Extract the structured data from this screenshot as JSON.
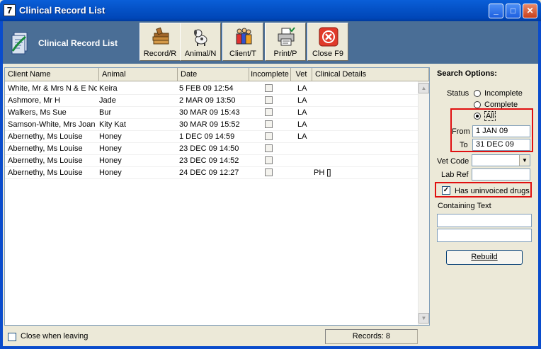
{
  "window": {
    "title": "Clinical Record List",
    "app_icon_glyph": "7",
    "minimize_glyph": "_",
    "maximize_glyph": "□",
    "close_glyph": "✕"
  },
  "toolbar": {
    "brand_label": "Clinical Record List",
    "buttons": [
      {
        "label": "Record/R",
        "icon": "books-icon"
      },
      {
        "label": "Animal/N",
        "icon": "dog-icon"
      },
      {
        "label": "Client/T",
        "icon": "people-icon"
      },
      {
        "label": "Print/P",
        "icon": "printer-icon"
      },
      {
        "label": "Close F9",
        "icon": "close-icon"
      }
    ]
  },
  "grid": {
    "columns": [
      "Client Name",
      "Animal",
      "Date",
      "Incomplete",
      "Vet",
      "Clinical Details"
    ],
    "rows": [
      {
        "client": "White, Mr & Mrs N & E Noe",
        "animal": "Keira",
        "date": "5 FEB 09  12:54",
        "incomplete": false,
        "vet": "LA",
        "details": ""
      },
      {
        "client": "Ashmore, Mr H",
        "animal": "Jade",
        "date": "2 MAR 09  13:50",
        "incomplete": false,
        "vet": "LA",
        "details": ""
      },
      {
        "client": "Walkers, Ms Sue",
        "animal": "Bur",
        "date": "30 MAR 09  15:43",
        "incomplete": false,
        "vet": "LA",
        "details": ""
      },
      {
        "client": "Samson-White, Mrs Joan",
        "animal": "Kity Kat",
        "date": "30 MAR 09  15:52",
        "incomplete": false,
        "vet": "LA",
        "details": ""
      },
      {
        "client": "Abernethy, Ms Louise",
        "animal": "Honey",
        "date": "1 DEC 09  14:59",
        "incomplete": false,
        "vet": "LA",
        "details": ""
      },
      {
        "client": "Abernethy, Ms Louise",
        "animal": "Honey",
        "date": "23 DEC 09  14:50",
        "incomplete": false,
        "vet": "",
        "details": ""
      },
      {
        "client": "Abernethy, Ms Louise",
        "animal": "Honey",
        "date": "23 DEC 09  14:52",
        "incomplete": false,
        "vet": "",
        "details": ""
      },
      {
        "client": "Abernethy, Ms Louise",
        "animal": "Honey",
        "date": "24 DEC 09  12:27",
        "incomplete": false,
        "vet": "",
        "details": "PH []"
      }
    ]
  },
  "bottom": {
    "close_when_leaving_label": "Close when leaving",
    "close_when_leaving_checked": false,
    "records_text": "Records: 8"
  },
  "search": {
    "title": "Search Options:",
    "status_label": "Status",
    "status_options": [
      "Incomplete",
      "Complete",
      "All"
    ],
    "status_selected": "All",
    "from_label": "From",
    "from_value": "1 JAN 09",
    "to_label": "To",
    "to_value": "31 DEC 09",
    "vet_code_label": "Vet Code",
    "vet_code_value": "",
    "lab_ref_label": "Lab Ref",
    "lab_ref_value": "",
    "uninvoiced_label": "Has uninvoiced drugs",
    "uninvoiced_checked": true,
    "containing_text_label": "Containing Text",
    "containing_text_1": "",
    "containing_text_2": "",
    "rebuild_label": "Rebuild"
  },
  "colors": {
    "titlebar": "#0553c8",
    "toolbar": "#4a6e96",
    "highlight_box": "#e01010"
  }
}
